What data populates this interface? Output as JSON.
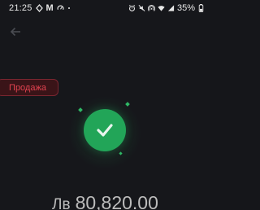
{
  "status_bar": {
    "time": "21:25",
    "app_icon_label": "M",
    "battery": "35%"
  },
  "header": {
    "back_icon": "arrow-left-icon"
  },
  "badge": {
    "label": "Продажа",
    "color": "#e0424f"
  },
  "success": {
    "icon": "checkmark-icon",
    "color": "#22a558"
  },
  "amount": {
    "currency": "Лв",
    "value": "80,820.00"
  }
}
